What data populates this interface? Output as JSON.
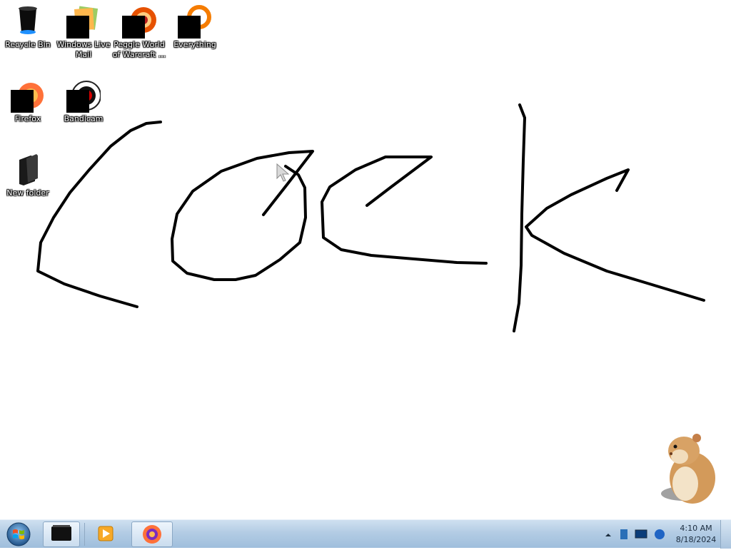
{
  "desktop": {
    "icons": [
      {
        "label": "Recycle Bin"
      },
      {
        "label": "Windows Live Mail"
      },
      {
        "label": "Peggle World of Warcraft ..."
      },
      {
        "label": "Everything"
      },
      {
        "label": "Firefox"
      },
      {
        "label": "Bandicam"
      },
      {
        "label": "New folder"
      }
    ]
  },
  "taskbar": {
    "start_icon": "windows-orb-icon",
    "pinned": [
      {
        "icon": "black-window-icon"
      },
      {
        "icon": "media-player-icon"
      },
      {
        "icon": "firefox-icon"
      }
    ],
    "tray": {
      "icons": [
        "show-hidden-icons-arrow",
        "network-icon",
        "monitor-icon",
        "volume-icon"
      ],
      "time": "4:10 AM",
      "date": "8/18/2024"
    }
  },
  "colors": {
    "taskbar": "#b3cce4",
    "stroke": "#000000",
    "desktop": "#ffffff"
  }
}
